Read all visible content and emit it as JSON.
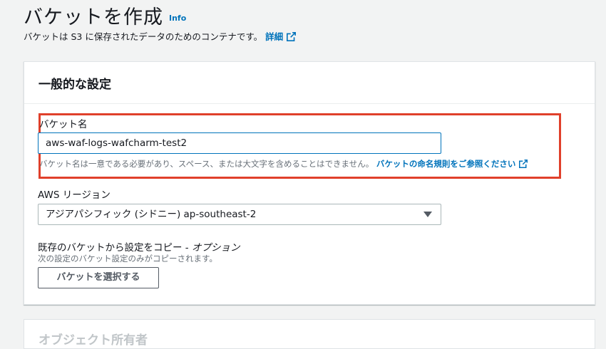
{
  "page": {
    "title": "バケットを作成",
    "info_label": "Info",
    "subtitle": "バケットは S3 に保存されたデータのためのコンテナです。",
    "subtitle_link": "詳細"
  },
  "general": {
    "title": "一般的な設定",
    "bucket_name_label": "バケット名",
    "bucket_name_value": "aws-waf-logs-wafcharm-test2",
    "bucket_name_constraint": "バケット名は一意である必要があり、スペース、または大文字を含めることはできません。",
    "naming_rules_link": "バケットの命名規則をご参照ください",
    "region_label": "AWS リージョン",
    "region_value": "アジアパシフィック (シドニー) ap-southeast-2",
    "copy_label": "既存のバケットから設定をコピー - ",
    "copy_optional": "オプション",
    "copy_description": "次の設定のバケット設定のみがコピーされます。",
    "choose_bucket_button": "バケットを選択する"
  },
  "next_section": {
    "title": "オブジェクト所有者"
  },
  "colors": {
    "link": "#0073bb",
    "highlight": "#e0402b",
    "background": "#f2f3f3"
  }
}
